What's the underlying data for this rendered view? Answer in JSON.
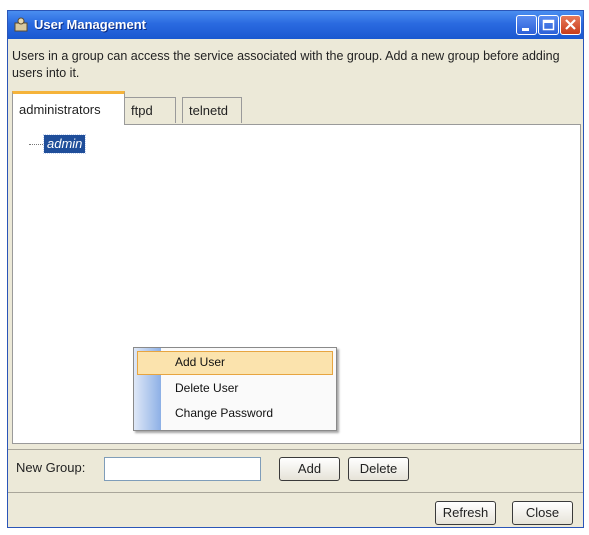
{
  "window": {
    "title": "User Management",
    "description": "Users in a group can access the service associated with the group. Add a new group before adding users into it."
  },
  "tabs": [
    {
      "label": "administrators",
      "active": true
    },
    {
      "label": "ftpd",
      "active": false
    },
    {
      "label": "telnetd",
      "active": false
    }
  ],
  "tree": {
    "nodes": [
      {
        "label": "admin",
        "selected": true
      }
    ]
  },
  "context_menu": {
    "items": [
      {
        "label": "Add User",
        "highlighted": true
      },
      {
        "label": "Delete User",
        "highlighted": false
      },
      {
        "label": "Change Password",
        "highlighted": false
      }
    ]
  },
  "new_group": {
    "label": "New Group:",
    "value": "",
    "add_label": "Add",
    "delete_label": "Delete"
  },
  "footer": {
    "refresh_label": "Refresh",
    "close_label": "Close"
  },
  "colors": {
    "titlebar": "#2a6ae0",
    "selection": "#1f4e9a",
    "menu_highlight": "#fbe3ad",
    "tab_accent": "#f5b33a"
  }
}
